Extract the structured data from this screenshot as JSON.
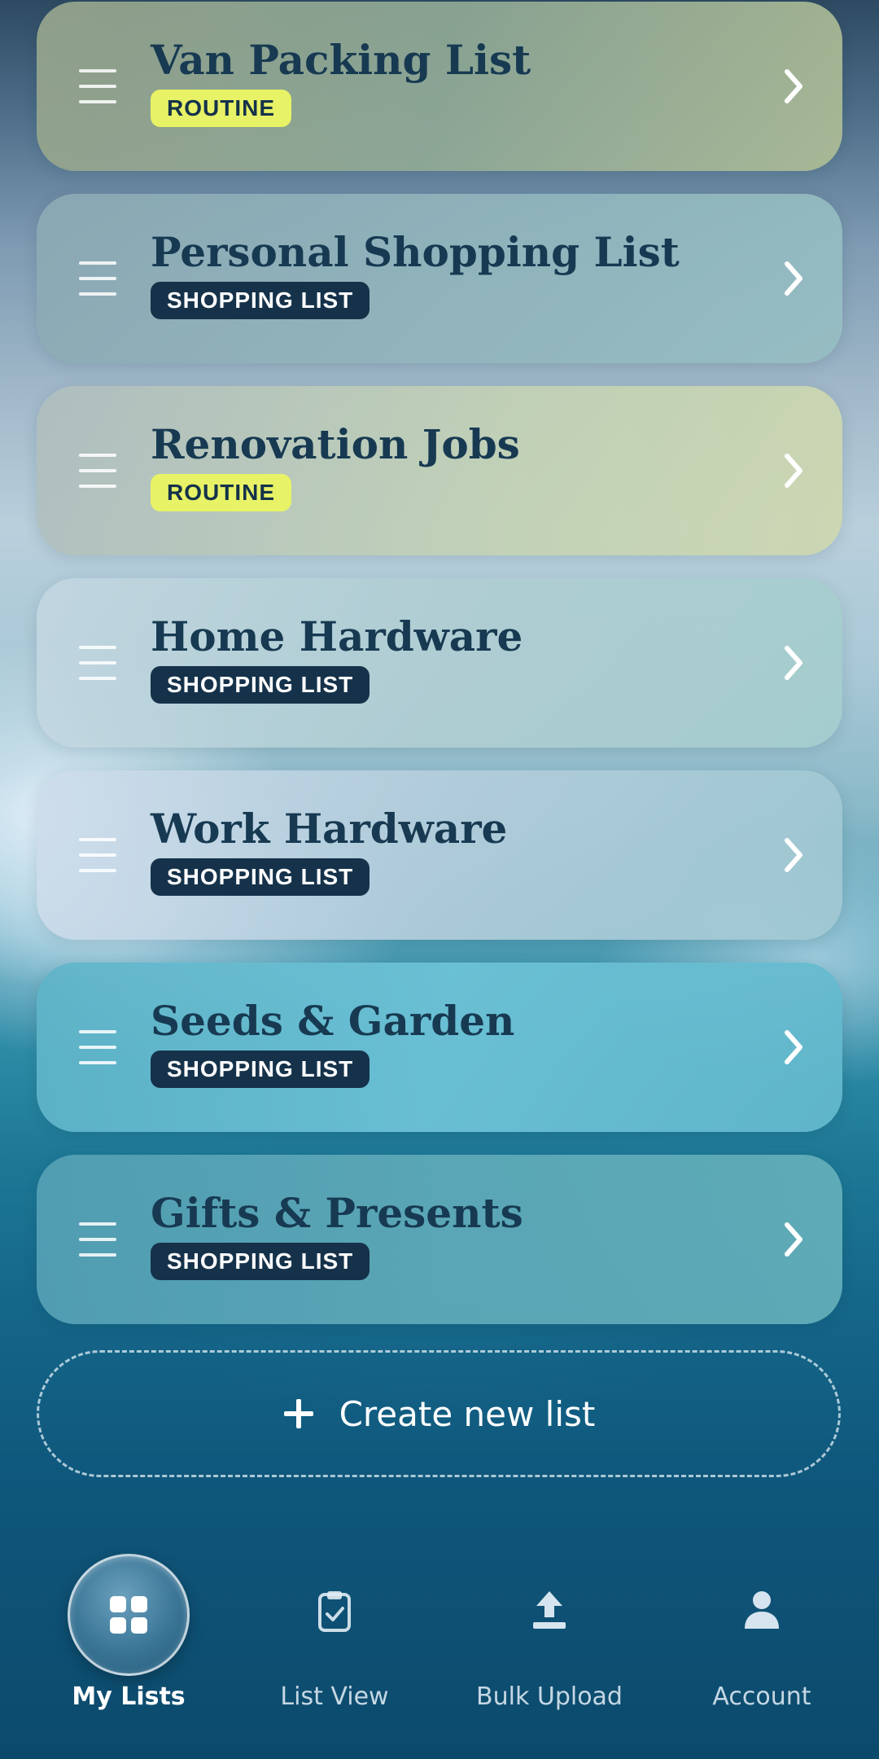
{
  "lists": [
    {
      "title": "Van Packing List",
      "type": "ROUTINE"
    },
    {
      "title": "Personal Shopping List",
      "type": "SHOPPING LIST"
    },
    {
      "title": "Renovation Jobs",
      "type": "ROUTINE"
    },
    {
      "title": "Home Hardware",
      "type": "SHOPPING LIST"
    },
    {
      "title": "Work Hardware",
      "type": "SHOPPING LIST"
    },
    {
      "title": "Seeds & Garden",
      "type": "SHOPPING LIST"
    },
    {
      "title": "Gifts & Presents",
      "type": "SHOPPING LIST"
    }
  ],
  "create_button": {
    "label": "Create new list",
    "icon": "plus-icon"
  },
  "nav": {
    "items": [
      {
        "label": "My Lists",
        "icon": "grid-icon",
        "active": true
      },
      {
        "label": "List View",
        "icon": "clipboard-check-icon",
        "active": false
      },
      {
        "label": "Bulk Upload",
        "icon": "upload-icon",
        "active": false
      },
      {
        "label": "Account",
        "icon": "user-icon",
        "active": false
      }
    ]
  },
  "colors": {
    "routine_badge": "#e8f266",
    "shopping_badge": "#15324a",
    "title_text": "#173a52"
  }
}
